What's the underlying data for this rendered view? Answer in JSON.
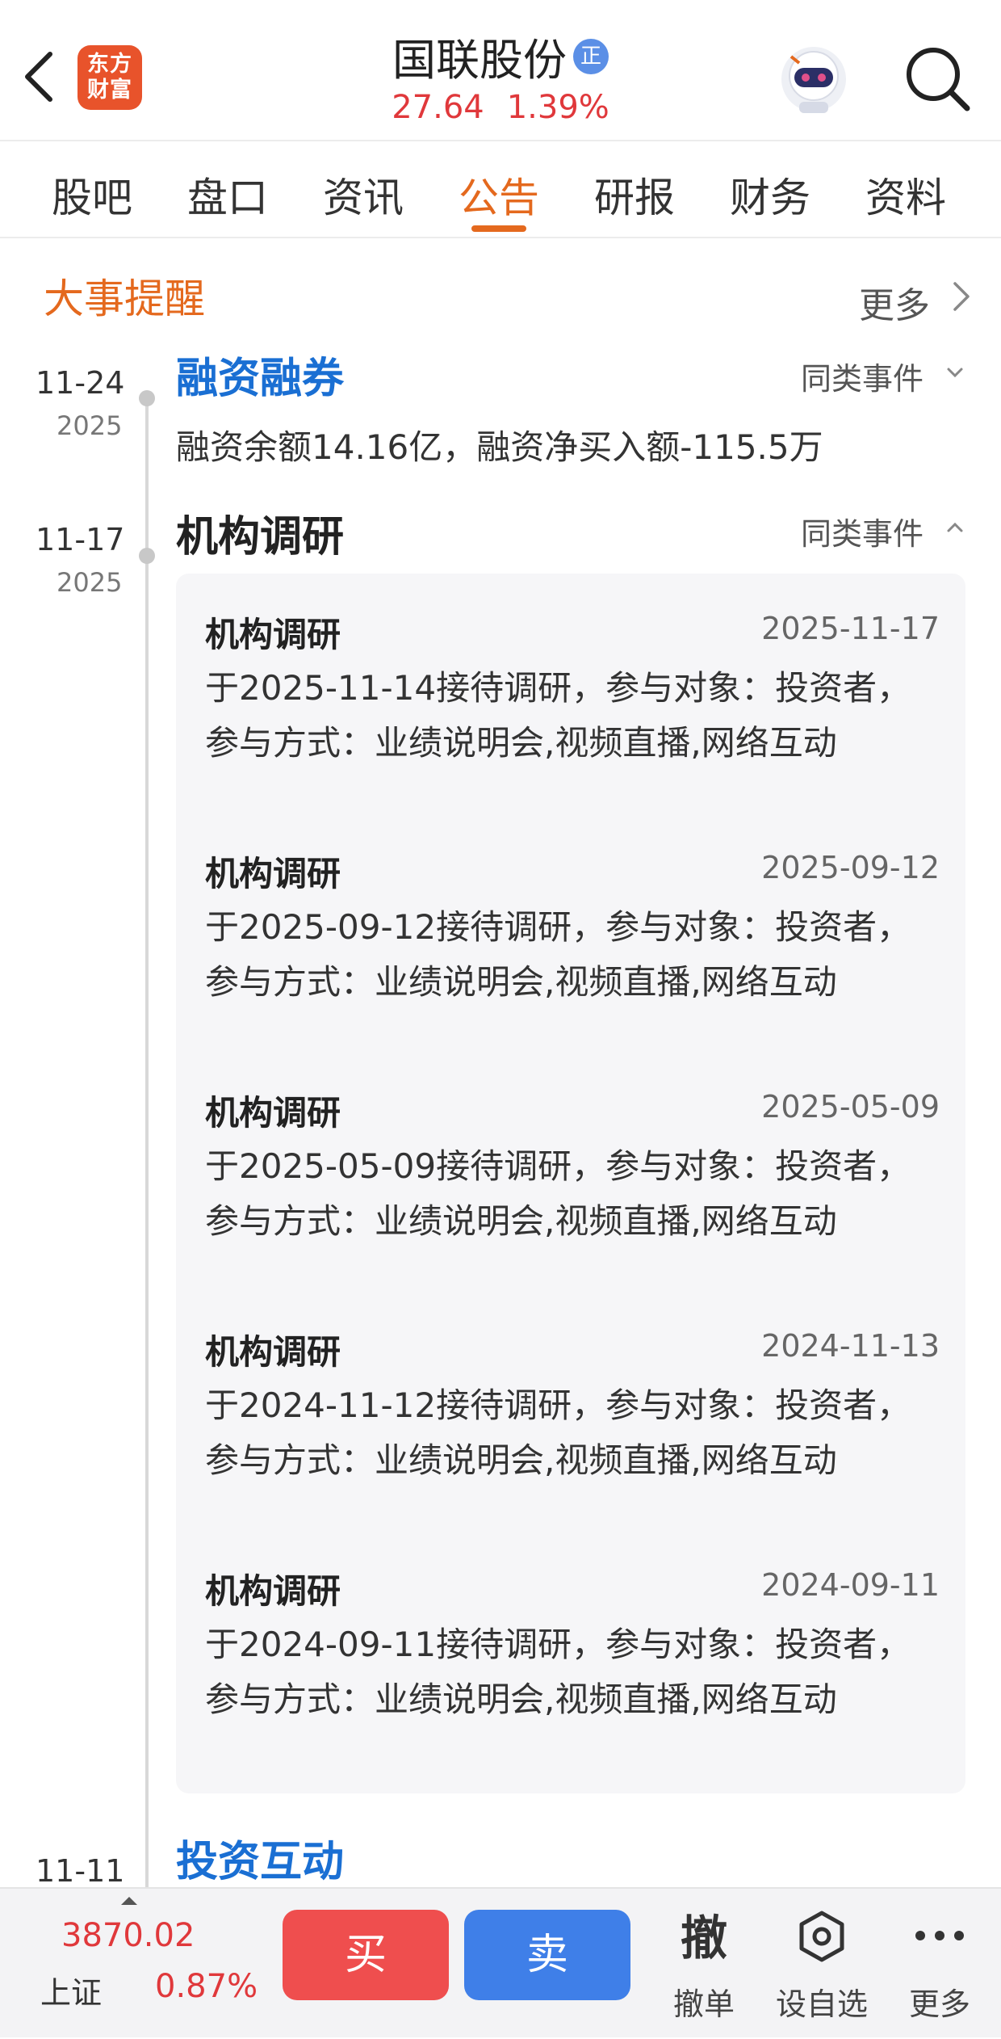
{
  "header": {
    "logo_text_1": "东方",
    "logo_text_2": "财富",
    "stock_name": "国联股份",
    "badge": "正",
    "price": "27.64",
    "change_pct": "1.39%"
  },
  "tabs": [
    {
      "label": "股吧"
    },
    {
      "label": "盘口"
    },
    {
      "label": "资讯"
    },
    {
      "label": "公告"
    },
    {
      "label": "研报"
    },
    {
      "label": "财务"
    },
    {
      "label": "资料"
    }
  ],
  "active_tab": "公告",
  "section": {
    "title": "大事提醒",
    "more": "更多"
  },
  "events": [
    {
      "date_md": "11-24",
      "year": "2025",
      "title": "融资融券",
      "same_type": "同类事件",
      "desc": "融资余额14.16亿，融资净买入额-115.5万"
    },
    {
      "date_md": "11-17",
      "year": "2025",
      "title": "机构调研",
      "same_type": "同类事件",
      "items": [
        {
          "title": "机构调研",
          "date": "2025-11-17",
          "text": "于2025-11-14接待调研，参与对象：投资者，参与方式：业绩说明会,视频直播,网络互动"
        },
        {
          "title": "机构调研",
          "date": "2025-09-12",
          "text": "于2025-09-12接待调研，参与对象：投资者，参与方式：业绩说明会,视频直播,网络互动"
        },
        {
          "title": "机构调研",
          "date": "2025-05-09",
          "text": "于2025-05-09接待调研，参与对象：投资者，参与方式：业绩说明会,视频直播,网络互动"
        },
        {
          "title": "机构调研",
          "date": "2024-11-13",
          "text": "于2024-11-12接待调研，参与对象：投资者，参与方式：业绩说明会,视频直播,网络互动"
        },
        {
          "title": "机构调研",
          "date": "2024-09-11",
          "text": "于2024-09-11接待调研，参与对象：投资者，参与方式：业绩说明会,视频直播,网络互动"
        }
      ]
    },
    {
      "date_md": "11-11",
      "title": "投资互动"
    }
  ],
  "bottom_bar": {
    "index_value": "3870.02",
    "index_name": "上证",
    "index_pct": "0.87%",
    "buy": "买",
    "sell": "卖",
    "cancel_icon": "撤",
    "cancel": "撤单",
    "watch": "设自选",
    "more": "更多"
  },
  "colors": {
    "accent_orange": "#e4691e",
    "up_red": "#e0383b",
    "link_blue": "#1a6fd3",
    "buy_red": "#ef4e4e",
    "sell_blue": "#3f7fe8"
  },
  "icons": [
    "back-arrow-icon",
    "robot-assistant-icon",
    "search-icon",
    "chevron-right-icon",
    "chevron-down-icon",
    "chevron-up-icon",
    "settings-hexagon-icon",
    "more-dots-icon"
  ]
}
